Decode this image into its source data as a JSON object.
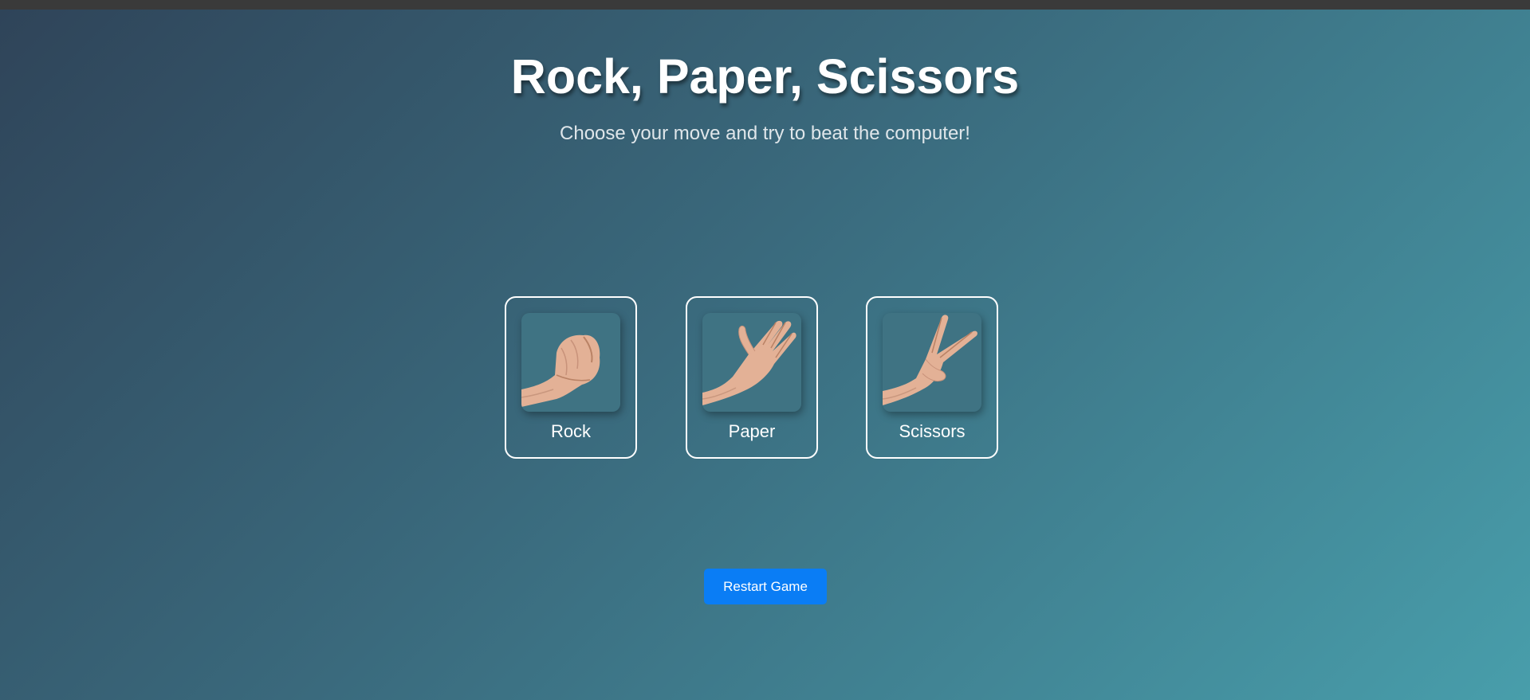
{
  "game": {
    "title": "Rock, Paper, Scissors",
    "subtitle": "Choose your move and try to beat the computer!"
  },
  "choices": [
    {
      "label": "Rock",
      "icon": "fist-hand-icon"
    },
    {
      "label": "Paper",
      "icon": "open-hand-icon"
    },
    {
      "label": "Scissors",
      "icon": "peace-sign-hand-icon"
    }
  ],
  "actions": {
    "restart_label": "Restart Game"
  },
  "colors": {
    "background_start": "#2f4459",
    "background_end": "#489eab",
    "accent_button": "#0a7df5",
    "tile": "#3f7383",
    "skin": "#e3b196"
  }
}
